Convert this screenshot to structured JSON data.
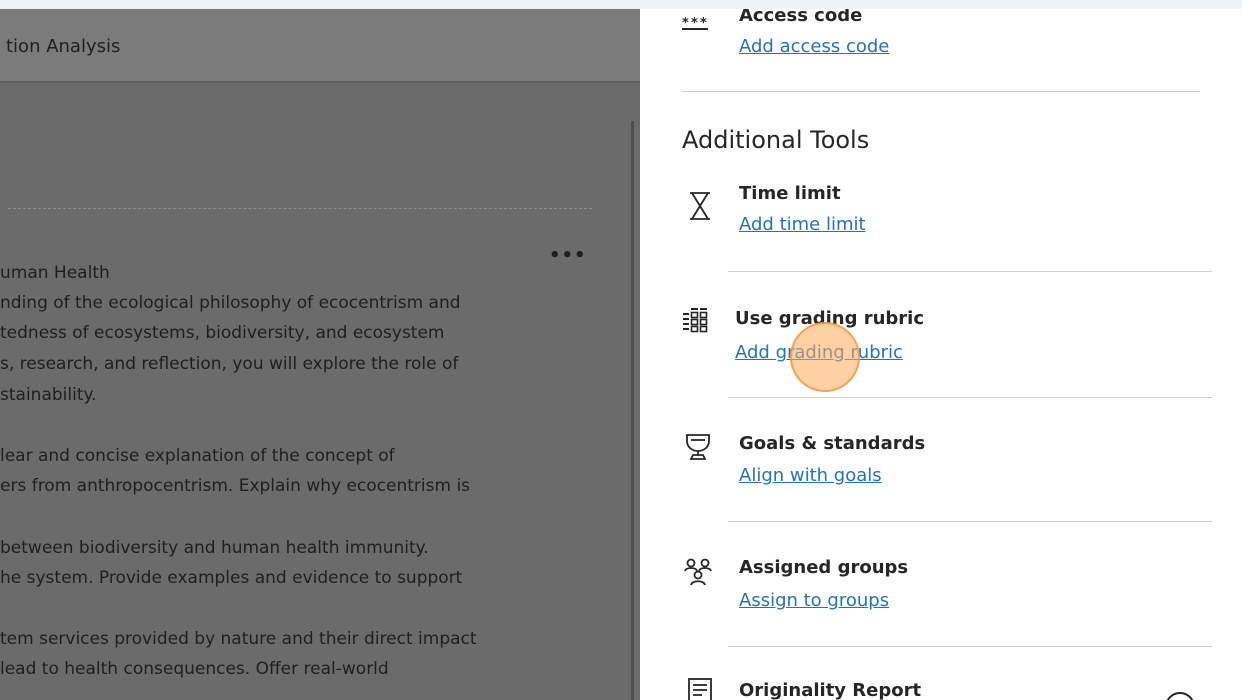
{
  "left": {
    "title": "tion Analysis",
    "more_label": "•••",
    "lines": [
      "uman Health",
      "nding of the ecological philosophy of ecocentrism and",
      "tedness of ecosystems, biodiversity, and ecosystem",
      "s, research, and reflection, you will explore the role of",
      "stainability.",
      "lear and concise explanation of the concept of",
      "ers from anthropocentrism. Explain why ecocentrism is",
      " between biodiversity and human health immunity.",
      "he system. Provide examples and evidence to support",
      "tem services provided by nature and their direct impact",
      " lead to health consequences. Offer real-world"
    ]
  },
  "right": {
    "access_code": {
      "title": "Access code",
      "link": "Add access code",
      "icon": "asterisks-icon"
    },
    "additional_tools_heading": "Additional Tools",
    "time_limit": {
      "title": "Time limit",
      "link": "Add time limit",
      "icon": "hourglass-icon"
    },
    "grading_rubric": {
      "title": "Use grading rubric",
      "link": "Add grading rubric",
      "icon": "rubric-grid-icon"
    },
    "goals": {
      "title": "Goals & standards",
      "link": "Align with goals",
      "icon": "trophy-icon"
    },
    "groups": {
      "title": "Assigned groups",
      "link": "Assign to groups",
      "icon": "people-icon"
    },
    "originality": {
      "title": "Originality Report",
      "icon": "report-icon"
    }
  },
  "colors": {
    "link": "#2871b8",
    "overlay": "#6b6b6b",
    "click_marker": "#ffaa5a"
  }
}
